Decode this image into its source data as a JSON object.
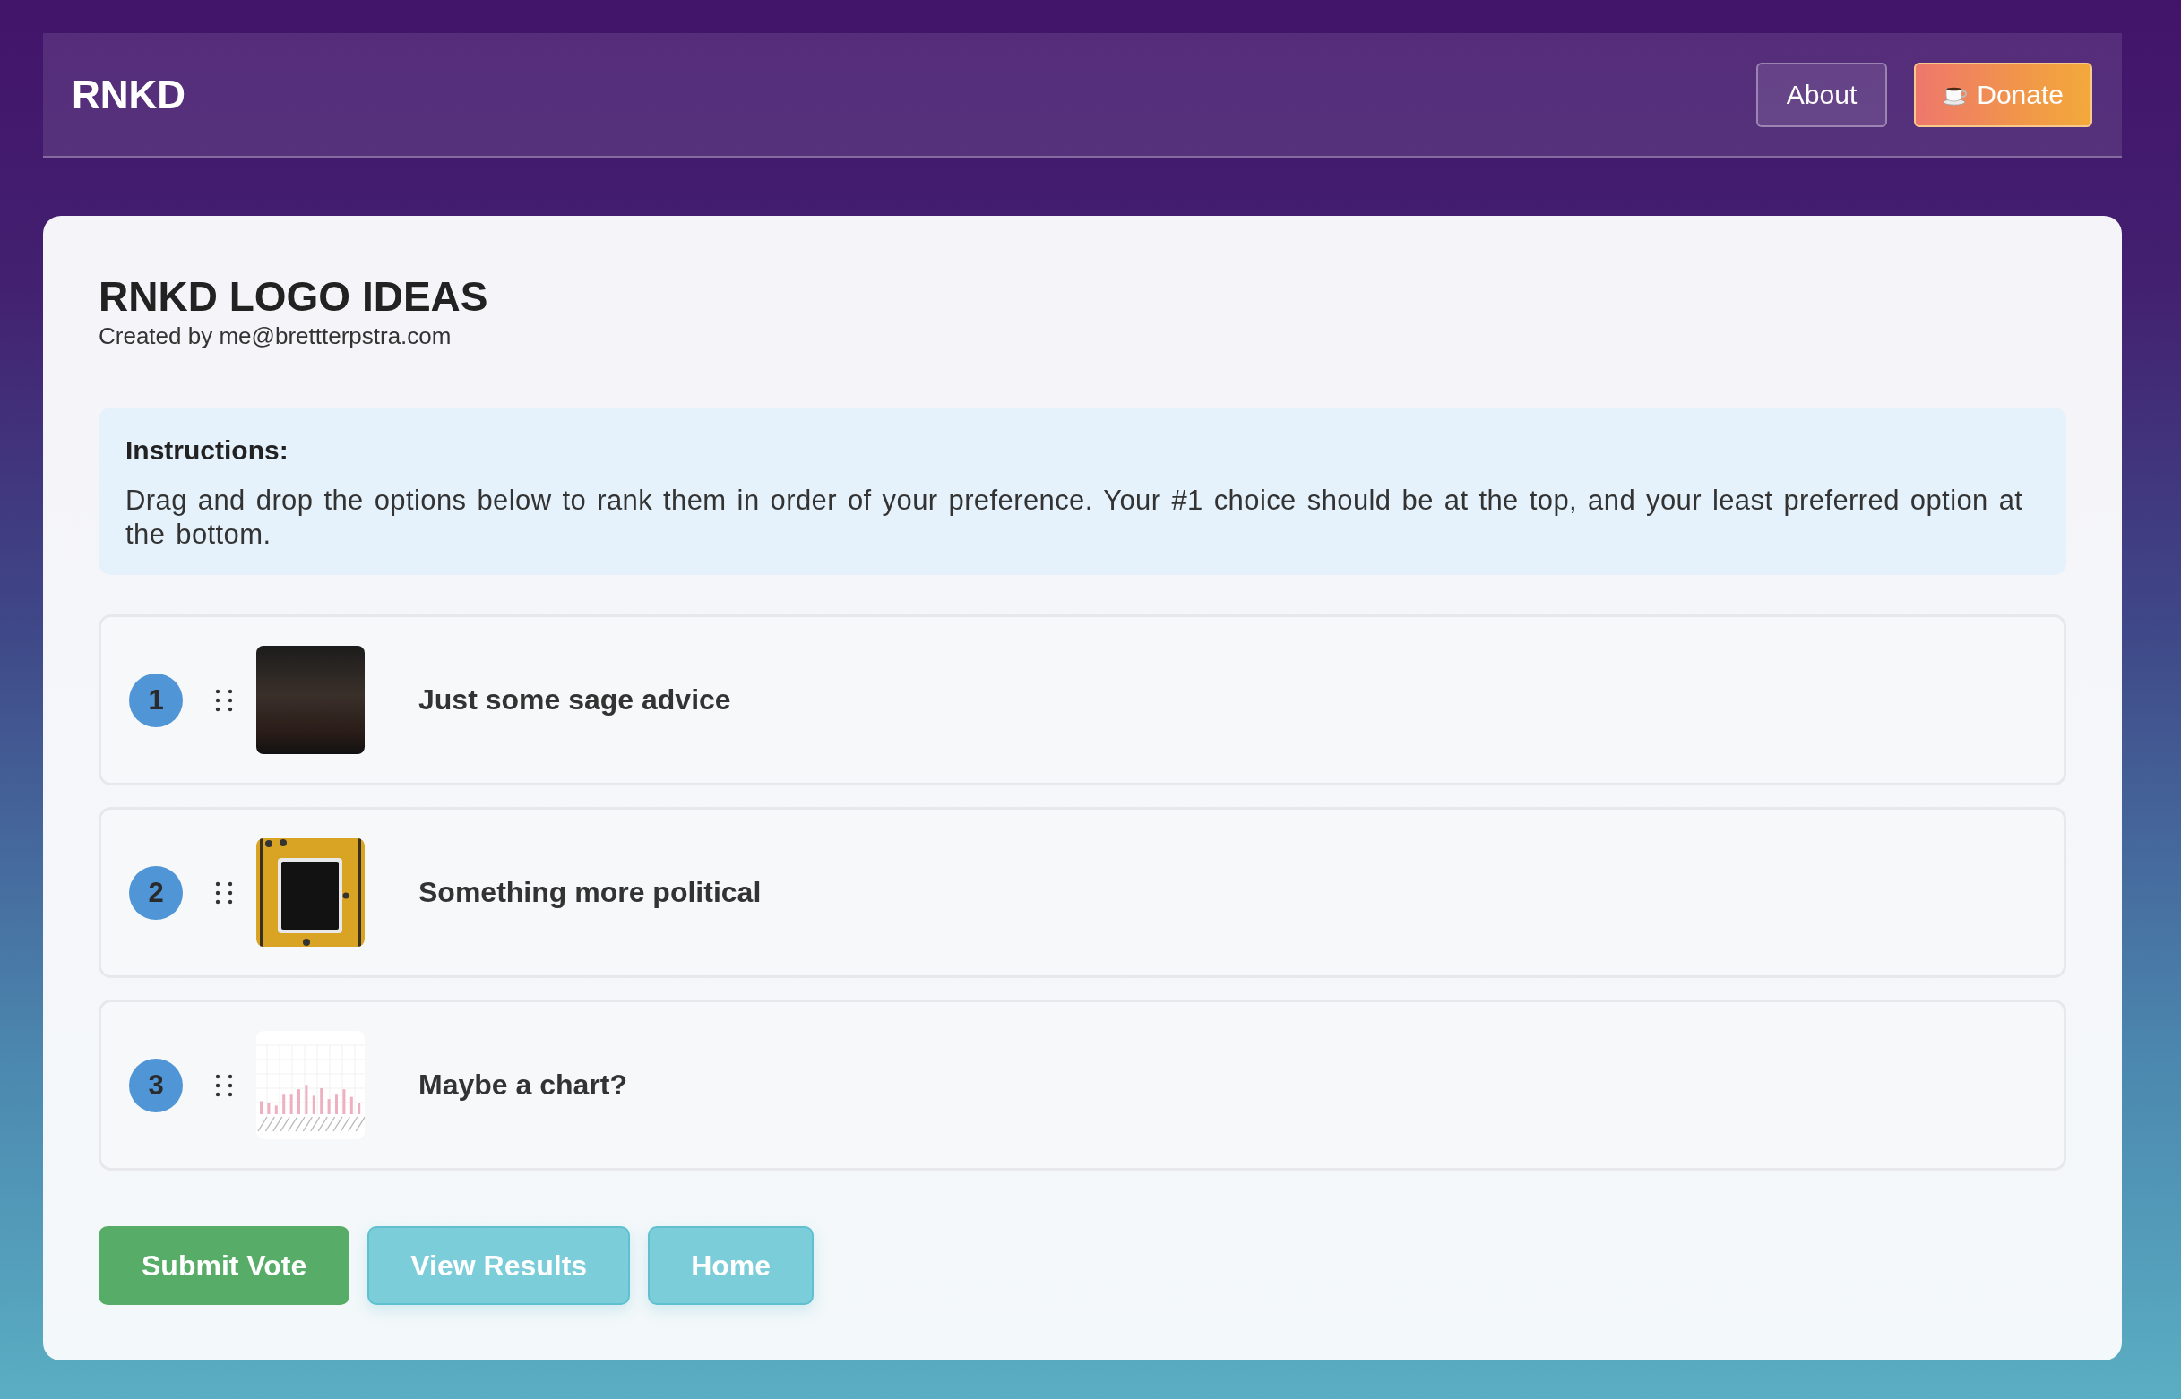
{
  "header": {
    "logo": "RNKD",
    "nav": [
      {
        "label": "About",
        "kind": "outline"
      },
      {
        "label": "Donate",
        "kind": "donate"
      }
    ]
  },
  "poll": {
    "title": "RNKD LOGO IDEAS",
    "creator": "Created by me@brettterpstra.com"
  },
  "instructions": {
    "heading": "Instructions:",
    "text": "Drag and drop the options below to rank them in order of your preference. Your #1 choice should be at the top, and your least preferred option at the bottom."
  },
  "options": [
    {
      "rank": "1",
      "label": "Just some sage advice",
      "kind": "photo"
    },
    {
      "rank": "2",
      "label": "Something more political",
      "kind": "poster"
    },
    {
      "rank": "3",
      "label": "Maybe a chart?",
      "kind": "chart"
    }
  ],
  "actions": [
    {
      "label": "Submit Vote",
      "kind": "primary"
    },
    {
      "label": "View Results",
      "kind": "secondary"
    },
    {
      "label": "Home",
      "kind": "secondary"
    }
  ]
}
